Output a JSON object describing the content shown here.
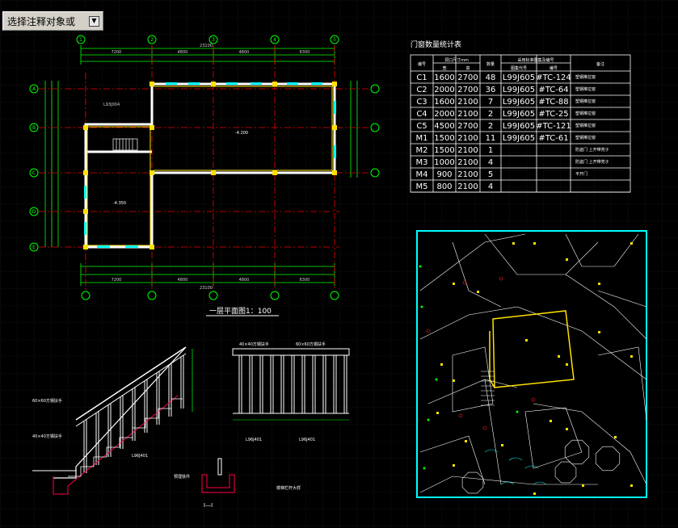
{
  "prompt": {
    "text": "选择注释对象或",
    "dropdown_icon": "chevron-down-icon"
  },
  "plan": {
    "title": "一层平面图1：100",
    "axes_top": [
      "1",
      "2",
      "3",
      "4",
      "5"
    ],
    "axes_left": [
      "A",
      "B",
      "C",
      "D",
      "E"
    ],
    "dim_top_total": "23100",
    "dim_top_segs": [
      "7200",
      "4800",
      "4800",
      "6300"
    ],
    "dim_bottom_total": "23100",
    "dim_bottom_segs": [
      "7200",
      "4800",
      "4800",
      "6300"
    ],
    "label_stair": "L93J004",
    "label_elev1": "-4.200",
    "label_elev2": "-4.350"
  },
  "table": {
    "title": "门窗数量统计表",
    "headers": {
      "code": "编号",
      "size": "洞口尺寸mm",
      "width": "宽",
      "height": "高",
      "qty": "数量",
      "std": "采用标准图集及编号",
      "atlas": "图集代号",
      "num": "编号",
      "remark": "备注"
    },
    "rows": [
      {
        "code": "C1",
        "w": "1600",
        "h": "2700",
        "q": "48",
        "atlas": "L99J605",
        "num": "#TC-124",
        "remark": "塑钢推拉窗"
      },
      {
        "code": "C2",
        "w": "2000",
        "h": "2700",
        "q": "36",
        "atlas": "L99J605",
        "num": "#TC-64",
        "remark": "塑钢推拉窗"
      },
      {
        "code": "C3",
        "w": "1600",
        "h": "2100",
        "q": "7",
        "atlas": "L99J605",
        "num": "#TC-88",
        "remark": "塑钢推拉窗"
      },
      {
        "code": "C4",
        "w": "2000",
        "h": "2100",
        "q": "2",
        "atlas": "L99J605",
        "num": "#TC-25",
        "remark": "塑钢推拉窗"
      },
      {
        "code": "C5",
        "w": "4500",
        "h": "2700",
        "q": "2",
        "atlas": "L99J605",
        "num": "#TC-121",
        "remark": "塑钢推拉窗"
      },
      {
        "code": "M1",
        "w": "1500",
        "h": "2100",
        "q": "11",
        "atlas": "L99J605",
        "num": "#TC-61",
        "remark": "塑钢推拉窗"
      },
      {
        "code": "M2",
        "w": "1500",
        "h": "2100",
        "q": "1",
        "atlas": "",
        "num": "",
        "remark": "防盗门 上开带亮子"
      },
      {
        "code": "M3",
        "w": "1000",
        "h": "2100",
        "q": "4",
        "atlas": "",
        "num": "",
        "remark": "防盗门 上开带亮子"
      },
      {
        "code": "M4",
        "w": "900",
        "h": "2100",
        "q": "5",
        "atlas": "",
        "num": "",
        "remark": "平开门"
      },
      {
        "code": "M5",
        "w": "800",
        "h": "2100",
        "q": "4",
        "atlas": "",
        "num": "",
        "remark": ""
      }
    ]
  },
  "stair": {
    "label_top1": "40×40方钢扶手",
    "label_top2": "60×60方钢扶手",
    "label_l1": "60×60方钢扶手",
    "label_l2": "40×40方钢扶手",
    "label_ref1": "L96J401",
    "label_ref2": "L96J401",
    "label_ref3": "L96J401",
    "label_section": "I—I",
    "label_detail": "楼梯栏杆大样",
    "label_bar": "预埋铁件"
  }
}
